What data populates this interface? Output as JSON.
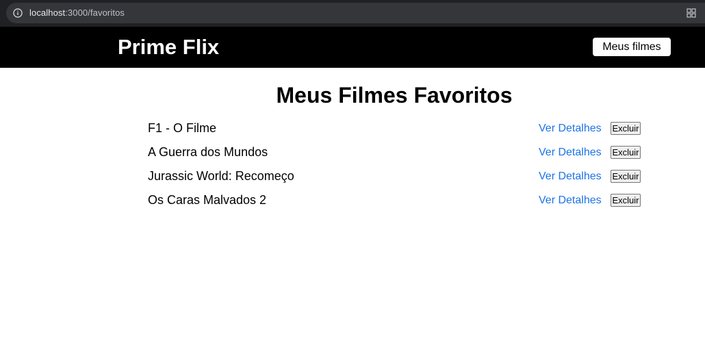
{
  "browser": {
    "url_host": "localhost",
    "url_path": ":3000/favoritos"
  },
  "header": {
    "logo": "Prime Flix",
    "favorites_link": "Meus filmes"
  },
  "main": {
    "title": "Meus Filmes Favoritos",
    "movies": [
      {
        "title": "F1 - O Filme",
        "details_label": "Ver Detalhes",
        "delete_label": "Excluir"
      },
      {
        "title": "A Guerra dos Mundos",
        "details_label": "Ver Detalhes",
        "delete_label": "Excluir"
      },
      {
        "title": "Jurassic World: Recomeço",
        "details_label": "Ver Detalhes",
        "delete_label": "Excluir"
      },
      {
        "title": "Os Caras Malvados 2",
        "details_label": "Ver Detalhes",
        "delete_label": "Excluir"
      }
    ]
  },
  "icons": {
    "info": "info-icon",
    "extension": "extensions-icon"
  },
  "colors": {
    "header_bg": "#000000",
    "link": "#1a73e8",
    "browser_bg": "#202124"
  }
}
